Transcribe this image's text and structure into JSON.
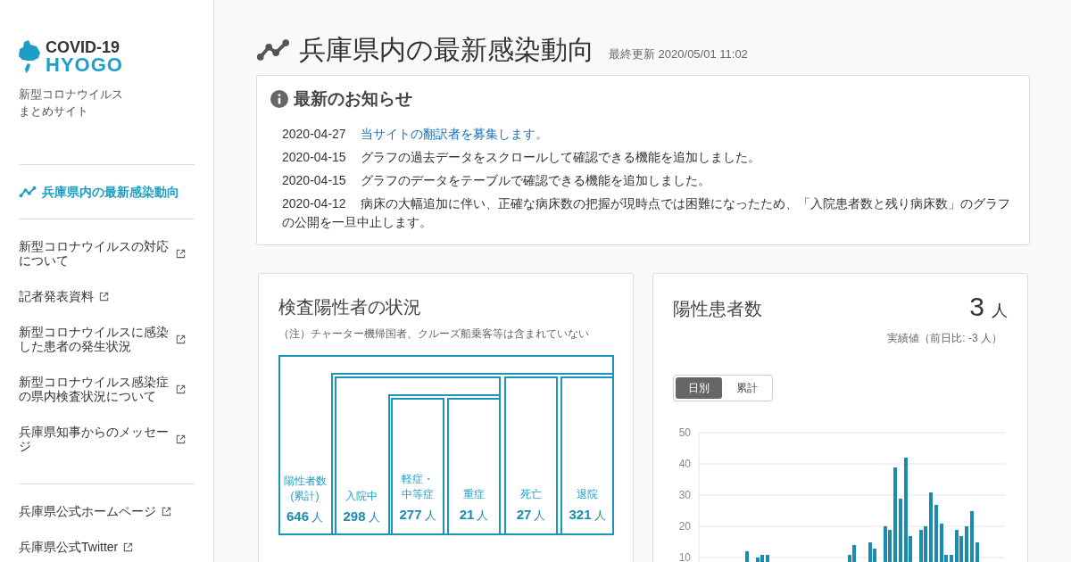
{
  "sidebar": {
    "logo": {
      "line_1": "COVID-19",
      "line_2": "HYOGO"
    },
    "subtitle": [
      "新型コロナウイルス",
      "まとめサイト"
    ],
    "groups": [
      [
        {
          "label": "兵庫県内の最新感染動向",
          "selected": true,
          "external": false
        }
      ],
      [
        {
          "label": "新型コロナウイルスの対応について",
          "selected": false,
          "external": true
        },
        {
          "label": "記者発表資料",
          "selected": false,
          "external": true
        },
        {
          "label": "新型コロナウイルスに感染した患者の発生状況",
          "selected": false,
          "external": true
        },
        {
          "label": "新型コロナウイルス感染症の県内検査状況について",
          "selected": false,
          "external": true
        },
        {
          "label": "兵庫県知事からのメッセージ",
          "selected": false,
          "external": true
        }
      ],
      [
        {
          "label": "兵庫県公式ホームページ",
          "selected": false,
          "external": true
        },
        {
          "label": "兵庫県公式Twitter",
          "selected": false,
          "external": true
        }
      ]
    ]
  },
  "page": {
    "title": "兵庫県内の最新感染動向",
    "updated": "最終更新 2020/05/01 11:02"
  },
  "notices": {
    "title": "最新のお知らせ",
    "items": [
      {
        "date": "2020-04-27",
        "text": "当サイトの翻訳者を募集します。",
        "link": true
      },
      {
        "date": "2020-04-15",
        "text": "グラフの過去データをスクロールして確認できる機能を追加しました。",
        "link": false
      },
      {
        "date": "2020-04-15",
        "text": "グラフのデータをテーブルで確認できる機能を追加しました。",
        "link": false
      },
      {
        "date": "2020-04-12",
        "text": "病床の大幅追加に伴い、正確な病床数の把握が現時点では困難になったため、「入院患者数と残り病床数」のグラフの公開を一旦中止します。",
        "link": false
      }
    ]
  },
  "positive_status": {
    "title": "検査陽性者の状況",
    "note": "（注）チャーター機帰国者、クルーズ船乗客等は含まれていない",
    "items": [
      {
        "label": [
          "陽性者数",
          "(累計)"
        ],
        "count": "646",
        "unit": "人"
      },
      {
        "label": [
          "入院中"
        ],
        "count": "298",
        "unit": "人"
      },
      {
        "label": [
          "軽症・",
          "中等症"
        ],
        "count": "277",
        "unit": "人"
      },
      {
        "label": [
          "重症"
        ],
        "count": "21",
        "unit": "人"
      },
      {
        "label": [
          "死亡"
        ],
        "count": "27",
        "unit": "人"
      },
      {
        "label": [
          "退院"
        ],
        "count": "321",
        "unit": "人"
      }
    ]
  },
  "positive_patients": {
    "title": "陽性患者数",
    "count": "3",
    "unit": "人",
    "subtext": "実績値（前日比: -3 人）",
    "toggle": [
      {
        "label": "日別",
        "selected": true
      },
      {
        "label": "累計",
        "selected": false
      }
    ],
    "chart_data": {
      "type": "bar",
      "grid": true,
      "ylim": [
        8.6,
        50
      ],
      "yticks": [
        10,
        20,
        30,
        40,
        50
      ],
      "series": [
        {
          "color": "#1b8cb0",
          "values": [
            null,
            null,
            null,
            null,
            null,
            null,
            null,
            null,
            null,
            12,
            null,
            10,
            11,
            11,
            null,
            null,
            null,
            null,
            null,
            null,
            null,
            null,
            null,
            null,
            null,
            null,
            null,
            null,
            null,
            11,
            14,
            null,
            null,
            15,
            13,
            null,
            20,
            19,
            39,
            29,
            42,
            17,
            null,
            19,
            20,
            31,
            27,
            21,
            11,
            11,
            19,
            17,
            20,
            25,
            15,
            null,
            null,
            null,
            null,
            null
          ]
        }
      ]
    }
  }
}
